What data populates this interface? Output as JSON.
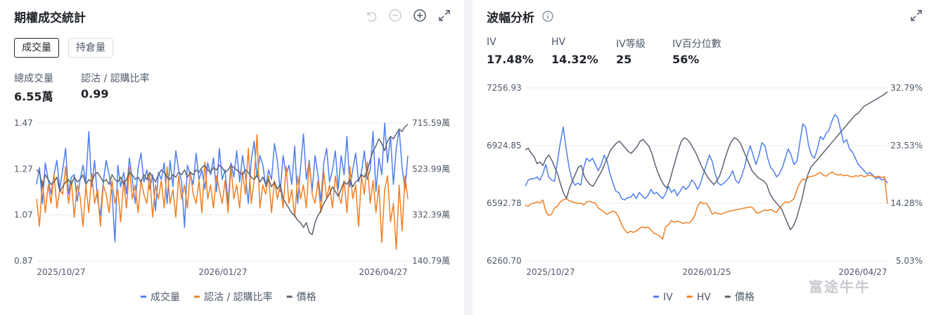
{
  "left": {
    "title": "期權成交統計",
    "tabs": [
      {
        "label": "成交量",
        "active": true
      },
      {
        "label": "持倉量",
        "active": false
      }
    ],
    "stats": [
      {
        "label": "總成交量",
        "value": "6.55萬"
      },
      {
        "label": "認沽 / 認購比率",
        "value": "0.99"
      }
    ],
    "icons": [
      "undo-icon",
      "zoom-out-icon",
      "zoom-in-icon",
      "expand-icon"
    ]
  },
  "right": {
    "title": "波幅分析",
    "info_icon": "info-icon",
    "stats": [
      {
        "label": "IV",
        "value": "17.48%"
      },
      {
        "label": "HV",
        "value": "14.32%"
      },
      {
        "label": "IV等級",
        "value": "25"
      },
      {
        "label": "IV百分位數",
        "value": "56%"
      }
    ]
  },
  "watermark": "富途牛牛",
  "colors": {
    "blue": "#4e7ef0",
    "orange": "#f07f24",
    "gray": "#5c6270",
    "grid": "#e9ebee"
  },
  "chart_data": [
    {
      "type": "line",
      "x_ticks": [
        "2025/10/27",
        "2026/01/27",
        "2026/04/27"
      ],
      "y_left_ticks": [
        "1.47",
        "1.27",
        "1.07",
        "0.87"
      ],
      "y_right_ticks": [
        "715.59萬",
        "523.99萬",
        "332.39萬",
        "140.79萬"
      ],
      "ylim_left": [
        0.87,
        1.47
      ],
      "ylim_right": [
        140.79,
        715.59
      ],
      "legend": [
        "成交量",
        "認沽 / 認購比率",
        "價格"
      ],
      "series": [
        {
          "name": "成交量",
          "color": "#4e7ef0",
          "axis": "right",
          "values": [
            460,
            530,
            380,
            550,
            480,
            420,
            500,
            560,
            440,
            520,
            610,
            420,
            490,
            500,
            390,
            480,
            540,
            470,
            680,
            450,
            560,
            400,
            330,
            470,
            560,
            500,
            430,
            220,
            540,
            450,
            510,
            420,
            570,
            480,
            380,
            530,
            590,
            470,
            520,
            440,
            500,
            350,
            510,
            480,
            550,
            380,
            560,
            450,
            600,
            520,
            470,
            280,
            540,
            500,
            460,
            590,
            480,
            520,
            440,
            550,
            500,
            570,
            430,
            610,
            480,
            520,
            380,
            550,
            490,
            600,
            470,
            580,
            500,
            380,
            560,
            640,
            490,
            580,
            540,
            450,
            520,
            480,
            630,
            560,
            430,
            580,
            500,
            540,
            460,
            620,
            380,
            530,
            670,
            480,
            560,
            430,
            580,
            500,
            390,
            550,
            610,
            470,
            520,
            600,
            440,
            580,
            500,
            660,
            450,
            520,
            590,
            470,
            510,
            600,
            480,
            520,
            680,
            430,
            570,
            500,
            720,
            550,
            660,
            460,
            610,
            690,
            530,
            440,
            580
          ]
        },
        {
          "name": "認沽 / 認購比率",
          "color": "#f07f24",
          "axis": "left",
          "values": [
            1.14,
            1.02,
            1.22,
            1.08,
            1.2,
            1.12,
            1.25,
            1.1,
            1.18,
            1.16,
            1.28,
            1.12,
            1.22,
            1.06,
            1.2,
            1.15,
            1.02,
            1.2,
            1.08,
            1.25,
            1.12,
            1.18,
            1.02,
            1.2,
            1.16,
            1.08,
            1.22,
            1.12,
            1.18,
            1.04,
            1.22,
            1.1,
            1.28,
            1.14,
            1.2,
            1.08,
            1.22,
            1.16,
            1.12,
            1.25,
            1.06,
            1.2,
            1.14,
            1.22,
            1.1,
            1.28,
            1.12,
            1.18,
            1.06,
            1.24,
            1.14,
            1.2,
            1.1,
            1.26,
            1.16,
            1.12,
            1.22,
            1.08,
            1.3,
            1.14,
            1.2,
            1.1,
            1.24,
            1.18,
            1.12,
            1.22,
            1.08,
            1.28,
            1.14,
            1.2,
            1.1,
            1.26,
            1.16,
            1.36,
            1.12,
            1.22,
            1.42,
            1.1,
            1.2,
            1.16,
            1.24,
            1.08,
            1.22,
            1.14,
            1.2,
            1.1,
            1.28,
            1.12,
            1.18,
            1.06,
            1.24,
            1.14,
            1.2,
            1.1,
            1.3,
            1.16,
            1.12,
            1.22,
            1.08,
            1.26,
            1.14,
            1.2,
            1.1,
            1.24,
            1.16,
            1.12,
            1.22,
            1.08,
            1.28,
            1.14,
            1.2,
            1.02,
            1.24,
            1.16,
            1.3,
            1.12,
            1.22,
            1.08,
            1.2,
            0.95,
            1.18,
            1.24,
            1.04,
            1.12,
            0.92,
            1.2,
            1.0,
            1.24,
            1.14
          ]
        },
        {
          "name": "價格",
          "color": "#5c6270",
          "axis": "right",
          "values": [
            520,
            510,
            450,
            500,
            480,
            460,
            470,
            490,
            430,
            450,
            470,
            480,
            460,
            490,
            470,
            480,
            500,
            460,
            480,
            470,
            500,
            510,
            490,
            470,
            480,
            460,
            500,
            480,
            470,
            490,
            460,
            480,
            510,
            500,
            480,
            490,
            470,
            500,
            480,
            510,
            490,
            470,
            500,
            520,
            510,
            490,
            480,
            500,
            490,
            510,
            500,
            520,
            490,
            510,
            500,
            520,
            510,
            530,
            540,
            520,
            510,
            530,
            520,
            540,
            530,
            510,
            520,
            540,
            530,
            520,
            510,
            500,
            520,
            510,
            490,
            480,
            500,
            470,
            490,
            460,
            480,
            450,
            470,
            440,
            460,
            400,
            380,
            360,
            340,
            330,
            310,
            300,
            280,
            300,
            260,
            250,
            300,
            330,
            350,
            380,
            400,
            420,
            450,
            430,
            410,
            440,
            470,
            460,
            480,
            450,
            470,
            480,
            500,
            490,
            520,
            560,
            600,
            620,
            650,
            630,
            600,
            640,
            660,
            650,
            670,
            690,
            680,
            700,
            710
          ]
        }
      ]
    },
    {
      "type": "line",
      "x_ticks": [
        "2025/10/27",
        "2026/01/25",
        "2026/04/27"
      ],
      "y_left_ticks": [
        "7256.93",
        "6924.85",
        "6592.78",
        "6260.70"
      ],
      "y_right_ticks": [
        "32.79%",
        "23.53%",
        "14.28%",
        "5.03%"
      ],
      "ylim_left": [
        6260.7,
        7256.93
      ],
      "ylim_right": [
        5.03,
        32.79
      ],
      "legend": [
        "IV",
        "HV",
        "價格"
      ],
      "series": [
        {
          "name": "IV",
          "color": "#4e7ef0",
          "axis": "right",
          "values": [
            17.0,
            18.0,
            18.2,
            18.2,
            18.5,
            18.0,
            19.0,
            20.5,
            18.5,
            18.0,
            17.8,
            21.0,
            24.0,
            26.5,
            23.0,
            20.0,
            18.0,
            17.2,
            17.5,
            17.2,
            20.0,
            21.5,
            21.0,
            21.5,
            20.5,
            19.5,
            20.5,
            22.0,
            21.0,
            19.0,
            17.5,
            16.2,
            16.0,
            15.0,
            14.8,
            15.2,
            15.2,
            15.8,
            15.0,
            16.0,
            15.5,
            15.0,
            15.5,
            16.5,
            15.8,
            16.0,
            15.5,
            15.0,
            15.8,
            17.0,
            16.0,
            16.5,
            15.5,
            16.2,
            17.0,
            16.5,
            17.0,
            18.0,
            17.5,
            16.5,
            17.5,
            19.0,
            20.5,
            22.0,
            21.0,
            19.0,
            17.5,
            17.2,
            17.5,
            18.0,
            18.5,
            19.5,
            18.0,
            17.5,
            18.5,
            20.0,
            22.0,
            23.5,
            22.0,
            20.5,
            22.0,
            24.0,
            23.5,
            21.5,
            20.0,
            19.5,
            18.5,
            19.0,
            20.0,
            21.5,
            23.0,
            22.0,
            20.5,
            21.0,
            24.0,
            27.0,
            26.5,
            23.5,
            22.0,
            21.5,
            23.0,
            25.0,
            24.5,
            25.5,
            26.0,
            27.5,
            28.5,
            28.0,
            26.0,
            24.0,
            24.5,
            23.0,
            22.5,
            21.5,
            20.5,
            20.0,
            19.5,
            19.0,
            19.2,
            18.8,
            18.2,
            18.5,
            18.0,
            18.2,
            17.5
          ]
        },
        {
          "name": "HV",
          "color": "#f07f24",
          "axis": "right",
          "values": [
            14.0,
            13.8,
            14.2,
            14.3,
            14.5,
            14.3,
            14.8,
            13.0,
            12.3,
            12.5,
            13.5,
            13.8,
            14.5,
            14.8,
            15.0,
            14.7,
            14.5,
            14.4,
            14.2,
            14.3,
            14.0,
            14.5,
            14.6,
            14.4,
            14.3,
            13.5,
            13.2,
            12.8,
            12.5,
            12.8,
            13.0,
            12.8,
            12.0,
            10.8,
            10.0,
            9.5,
            9.8,
            9.6,
            9.8,
            10.2,
            10.5,
            10.3,
            10.5,
            10.0,
            9.5,
            9.3,
            9.0,
            8.5,
            10.5,
            10.8,
            11.5,
            11.2,
            11.4,
            11.3,
            11.0,
            11.2,
            11.1,
            11.5,
            12.3,
            13.8,
            14.5,
            14.2,
            14.3,
            13.5,
            12.5,
            12.8,
            12.6,
            12.5,
            12.7,
            12.9,
            13.0,
            13.1,
            13.2,
            13.3,
            13.4,
            13.5,
            13.6,
            13.7,
            13.5,
            12.8,
            12.7,
            13.0,
            13.2,
            13.1,
            13.3,
            13.0,
            12.8,
            13.5,
            14.0,
            14.5,
            14.4,
            14.6,
            15.0,
            16.5,
            17.5,
            18.2,
            18.0,
            18.5,
            18.6,
            18.7,
            19.0,
            19.2,
            18.8,
            18.6,
            19.0,
            19.3,
            19.0,
            18.8,
            18.9,
            18.7,
            18.8,
            18.6,
            18.5,
            18.7,
            18.6,
            18.8,
            18.5,
            18.7,
            18.8,
            18.6,
            18.5,
            18.6,
            18.4,
            18.5,
            14.2
          ]
        },
        {
          "name": "價格",
          "color": "#5c6270",
          "axis": "left",
          "values": [
            6900,
            6910,
            6880,
            6860,
            6820,
            6830,
            6810,
            6850,
            6870,
            6840,
            6800,
            6760,
            6700,
            6650,
            6620,
            6680,
            6720,
            6760,
            6800,
            6810,
            6750,
            6720,
            6700,
            6690,
            6720,
            6750,
            6780,
            6820,
            6860,
            6900,
            6920,
            6940,
            6950,
            6930,
            6910,
            6890,
            6880,
            6900,
            6920,
            6950,
            6960,
            6940,
            6920,
            6880,
            6820,
            6770,
            6730,
            6700,
            6680,
            6720,
            6780,
            6840,
            6900,
            6950,
            6970,
            6960,
            6940,
            6910,
            6880,
            6840,
            6800,
            6770,
            6740,
            6720,
            6700,
            6720,
            6750,
            6800,
            6860,
            6910,
            6950,
            6970,
            6960,
            6940,
            6900,
            6860,
            6820,
            6780,
            6760,
            6740,
            6730,
            6720,
            6700,
            6650,
            6620,
            6600,
            6580,
            6560,
            6520,
            6480,
            6440,
            6460,
            6500,
            6560,
            6620,
            6700,
            6760,
            6800,
            6820,
            6840,
            6860,
            6880,
            6900,
            6920,
            6940,
            6960,
            6980,
            7000,
            7020,
            7040,
            7060,
            7080,
            7100,
            7110,
            7130,
            7150,
            7160,
            7170,
            7180,
            7190,
            7200,
            7210,
            7220,
            7235
          ]
        }
      ]
    }
  ]
}
